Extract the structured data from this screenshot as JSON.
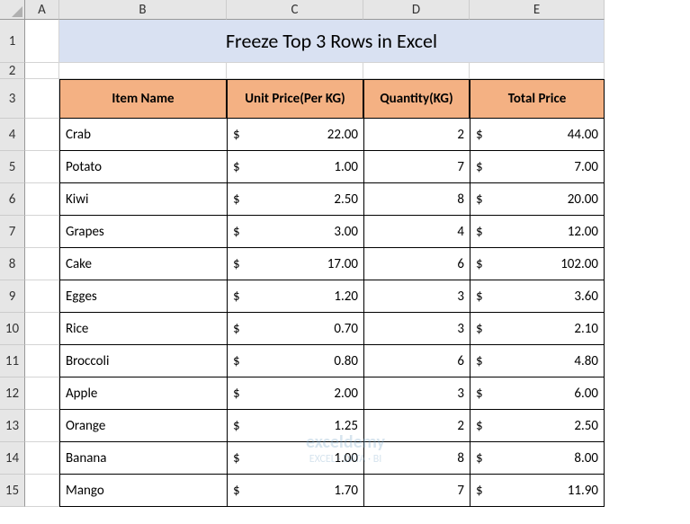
{
  "columns": [
    "",
    "A",
    "B",
    "C",
    "D",
    "E"
  ],
  "rows": [
    "1",
    "2",
    "3",
    "4",
    "5",
    "6",
    "7",
    "8",
    "9",
    "10",
    "11",
    "12",
    "13",
    "14",
    "15"
  ],
  "title": "Freeze Top 3 Rows in Excel",
  "headers": {
    "item": "Item Name",
    "unit": "Unit Price(Per KG)",
    "qty": "Quantity(KG)",
    "total": "Total Price"
  },
  "currency": "$",
  "data": [
    {
      "item": "Crab",
      "unit": "22.00",
      "qty": "2",
      "total": "44.00"
    },
    {
      "item": "Potato",
      "unit": "1.00",
      "qty": "7",
      "total": "7.00"
    },
    {
      "item": "Kiwi",
      "unit": "2.50",
      "qty": "8",
      "total": "20.00"
    },
    {
      "item": "Grapes",
      "unit": "3.00",
      "qty": "4",
      "total": "12.00"
    },
    {
      "item": "Cake",
      "unit": "17.00",
      "qty": "6",
      "total": "102.00"
    },
    {
      "item": "Egges",
      "unit": "1.20",
      "qty": "3",
      "total": "3.60"
    },
    {
      "item": "Rice",
      "unit": "0.70",
      "qty": "3",
      "total": "2.10"
    },
    {
      "item": "Broccoli",
      "unit": "0.80",
      "qty": "6",
      "total": "4.80"
    },
    {
      "item": "Apple",
      "unit": "2.00",
      "qty": "3",
      "total": "6.00"
    },
    {
      "item": "Orange",
      "unit": "1.25",
      "qty": "2",
      "total": "2.50"
    },
    {
      "item": "Banana",
      "unit": "1.00",
      "qty": "8",
      "total": "8.00"
    },
    {
      "item": "Mango",
      "unit": "1.70",
      "qty": "7",
      "total": "11.90"
    }
  ],
  "watermark": {
    "brand": "exceldemy",
    "tagline": "EXCEL · DATA · BI"
  }
}
